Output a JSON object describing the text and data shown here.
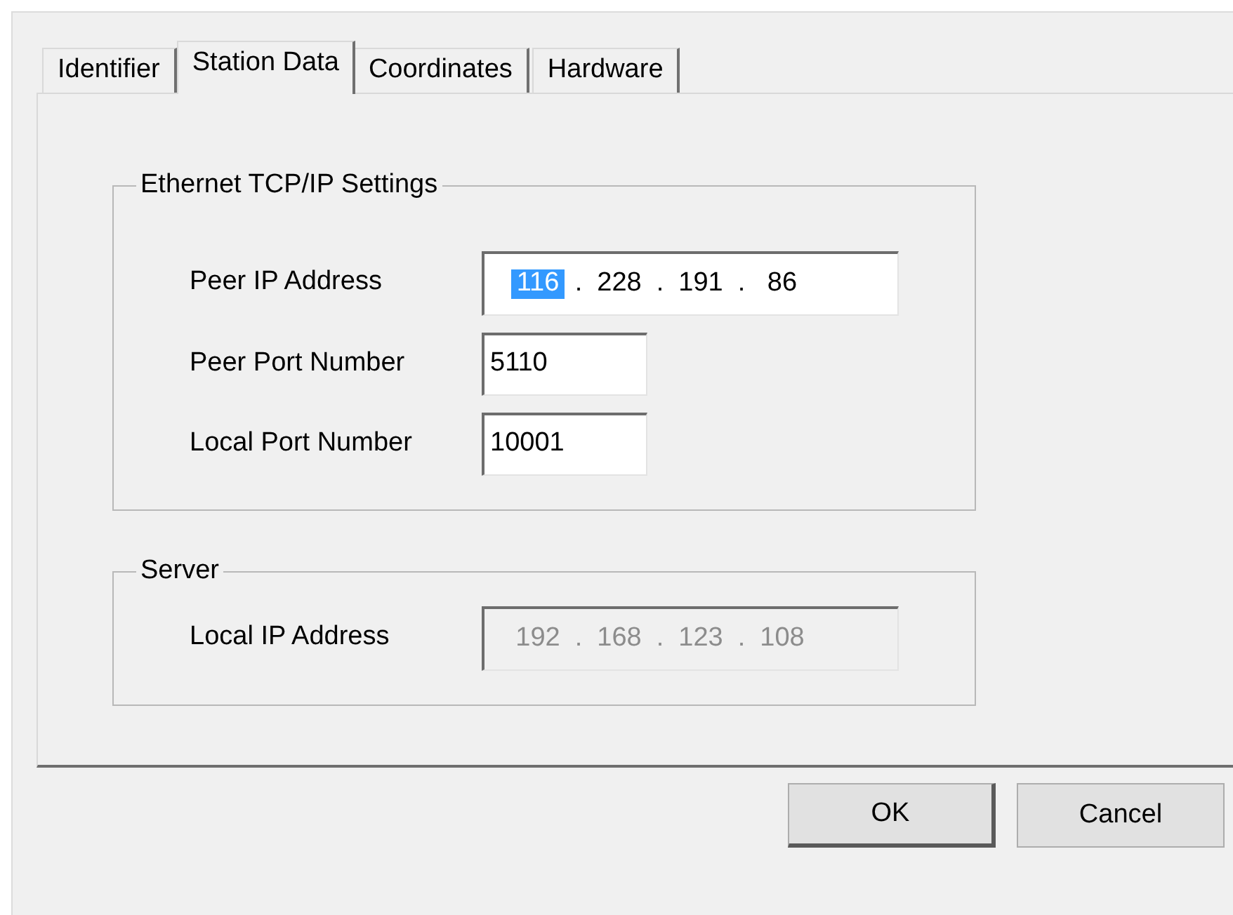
{
  "tabs": [
    {
      "label": "Identifier",
      "selected": false
    },
    {
      "label": "Station Data",
      "selected": true
    },
    {
      "label": "Coordinates",
      "selected": false
    },
    {
      "label": "Hardware",
      "selected": false
    }
  ],
  "groups": [
    {
      "title": "Ethernet TCP/IP Settings",
      "fields": [
        {
          "kind": "ip",
          "label": "Peer IP Address",
          "disabled": false,
          "octets": [
            {
              "text": "116",
              "selected": true
            },
            {
              "text": "228",
              "selected": false
            },
            {
              "text": "191",
              "selected": false
            },
            {
              "text": "86",
              "selected": false
            }
          ],
          "separators": [
            ".",
            ".",
            "."
          ]
        },
        {
          "kind": "text",
          "label": "Peer Port Number",
          "value": "5110",
          "disabled": false
        },
        {
          "kind": "text",
          "label": "Local Port Number",
          "value": "10001",
          "disabled": false
        }
      ]
    },
    {
      "title": "Server",
      "fields": [
        {
          "kind": "ip",
          "label": "Local IP Address",
          "disabled": true,
          "octets": [
            {
              "text": "192",
              "selected": false
            },
            {
              "text": "168",
              "selected": false
            },
            {
              "text": "123",
              "selected": false
            },
            {
              "text": "108",
              "selected": false
            }
          ],
          "separators": [
            ".",
            ".",
            "."
          ]
        }
      ]
    }
  ],
  "buttons": [
    {
      "label": "OK",
      "default": true
    },
    {
      "label": "Cancel",
      "default": false
    }
  ]
}
